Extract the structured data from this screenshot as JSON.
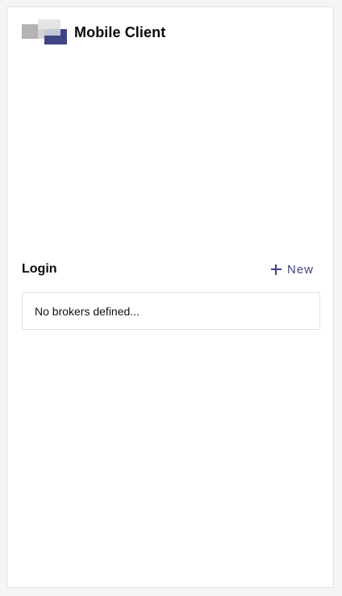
{
  "app": {
    "title": "Mobile Client",
    "logo_icon": "app-logo-icon"
  },
  "login": {
    "title": "Login",
    "new_label": "New",
    "new_icon": "plus-icon",
    "empty_message": "No brokers defined..."
  },
  "colors": {
    "accent": "#3e4582",
    "background": "#ffffff",
    "border": "#e0e0e0",
    "text": "#111111"
  }
}
